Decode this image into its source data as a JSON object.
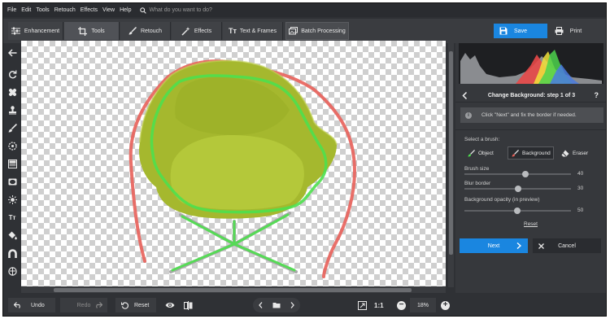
{
  "menubar": {
    "items": [
      "File",
      "Edit",
      "Tools",
      "Retouch",
      "Effects",
      "View",
      "Help"
    ],
    "search_placeholder": "What do you want to do?"
  },
  "toolbar": {
    "tabs": [
      {
        "label": "Enhancement",
        "icon": "sliders-icon"
      },
      {
        "label": "Tools",
        "icon": "crop-icon",
        "active": true
      },
      {
        "label": "Retouch",
        "icon": "brush-icon"
      },
      {
        "label": "Effects",
        "icon": "magic-wand-icon"
      },
      {
        "label": "Text & Frames",
        "icon": "text-icon"
      }
    ],
    "batch_label": "Batch Processing",
    "save_label": "Save",
    "print_label": "Print"
  },
  "panel": {
    "title": "Change Background: step 1 of 3",
    "help": "?",
    "info_icon": "i",
    "info": "Click \"Next\" and fix the border if needed.",
    "select_brush": "Select a brush:",
    "brushes": [
      "Object",
      "Background",
      "Eraser"
    ],
    "active_brush": "Background",
    "brush_size_label": "Brush size",
    "brush_size": "40",
    "blur_border_label": "Blur border",
    "blur_border": "30",
    "bg_opacity_label": "Background opacity (in preview)",
    "bg_opacity": "50",
    "reset_label": "Reset",
    "next_label": "Next",
    "cancel_label": "Cancel"
  },
  "bottombar": {
    "undo_label": "Undo",
    "redo_label": "Redo",
    "reset_label": "Reset",
    "zoom_one_to_one": "1:1",
    "zoom_level": "18%"
  },
  "colors": {
    "accent": "#1a86e0",
    "object_stroke": "#4ee04e",
    "background_stroke": "#e8605a"
  }
}
